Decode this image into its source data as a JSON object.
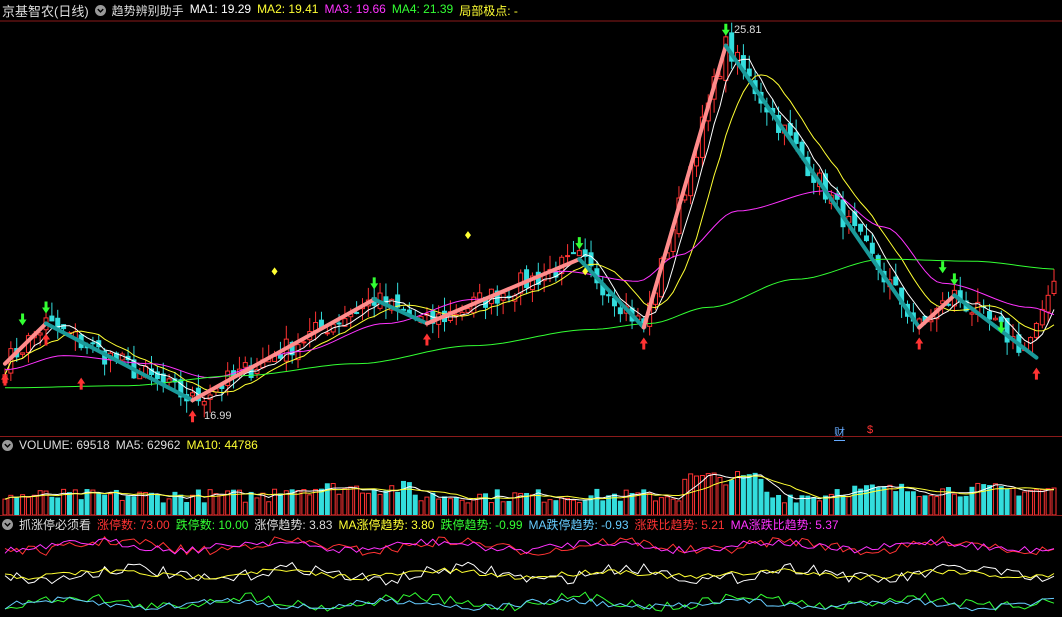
{
  "header": {
    "stock_name": "京基智农(日线)",
    "indicator_name": "趋势辨别助手",
    "items": [
      {
        "label": "MA1:",
        "value": "19.29",
        "color": "#ffffff"
      },
      {
        "label": "MA2:",
        "value": "19.41",
        "color": "#ffff33"
      },
      {
        "label": "MA3:",
        "value": "19.66",
        "color": "#ff33ff"
      },
      {
        "label": "MA4:",
        "value": "21.39",
        "color": "#33ff33"
      },
      {
        "label": "局部极点:",
        "value": "-",
        "color": "#ffff33"
      }
    ]
  },
  "annotations": {
    "high_label": "25.81",
    "low_label": "16.99",
    "tag_cai": "财",
    "tag_s": "$"
  },
  "volume_header": {
    "items": [
      {
        "label": "VOLUME:",
        "value": "69518",
        "color": "#dddddd"
      },
      {
        "label": "MA5:",
        "value": "62962",
        "color": "#dddddd"
      },
      {
        "label": "MA10:",
        "value": "44786",
        "color": "#ffff33"
      }
    ]
  },
  "limit_header": {
    "name": "抓涨停必须看",
    "items": [
      {
        "label": "涨停数:",
        "value": "73.00",
        "color": "#ff3333"
      },
      {
        "label": "跌停数:",
        "value": "10.00",
        "color": "#33ff33"
      },
      {
        "label": "涨停趋势:",
        "value": "3.83",
        "color": "#dddddd"
      },
      {
        "label": "MA涨停趋势:",
        "value": "3.80",
        "color": "#ffff33"
      },
      {
        "label": "跌停趋势:",
        "value": "-0.99",
        "color": "#33ff33"
      },
      {
        "label": "MA跌停趋势:",
        "value": "-0.93",
        "color": "#66ccff"
      },
      {
        "label": "涨跌比趋势:",
        "value": "5.21",
        "color": "#ff3333"
      },
      {
        "label": "MA涨跌比趋势:",
        "value": "5.37",
        "color": "#ff33ff"
      }
    ]
  },
  "colors": {
    "up": "#ff3333",
    "down": "#33dddd",
    "zigzag_up": "#ff8c8c",
    "zigzag_down": "#1a9a9a",
    "ma1": "#ffffff",
    "ma2": "#ffff33",
    "ma3": "#ff33ff",
    "ma4": "#33ff33"
  },
  "chart_data": {
    "type": "candlestick",
    "ylim": [
      16.2,
      26.4
    ],
    "candle_count": 180,
    "zigzag_points": [
      {
        "i": 0,
        "price": 17.9
      },
      {
        "i": 7,
        "price": 18.9
      },
      {
        "i": 32,
        "price": 16.99
      },
      {
        "i": 63,
        "price": 19.5
      },
      {
        "i": 72,
        "price": 18.9
      },
      {
        "i": 98,
        "price": 20.5
      },
      {
        "i": 109,
        "price": 18.8
      },
      {
        "i": 123,
        "price": 25.81
      },
      {
        "i": 156,
        "price": 18.8
      },
      {
        "i": 162,
        "price": 19.6
      },
      {
        "i": 176,
        "price": 18.05
      }
    ],
    "ma4": [
      [
        0,
        17.3
      ],
      [
        20,
        17.35
      ],
      [
        40,
        17.6
      ],
      [
        60,
        17.9
      ],
      [
        80,
        18.35
      ],
      [
        100,
        18.75
      ],
      [
        110,
        18.9
      ],
      [
        120,
        19.3
      ],
      [
        135,
        20.0
      ],
      [
        150,
        20.5
      ],
      [
        165,
        20.45
      ],
      [
        180,
        20.25
      ]
    ],
    "ma3": [
      [
        0,
        17.75
      ],
      [
        10,
        18.1
      ],
      [
        25,
        17.9
      ],
      [
        35,
        17.55
      ],
      [
        50,
        18.2
      ],
      [
        65,
        18.9
      ],
      [
        80,
        19.5
      ],
      [
        95,
        20.2
      ],
      [
        108,
        19.95
      ],
      [
        115,
        20.6
      ],
      [
        125,
        21.7
      ],
      [
        140,
        22.2
      ],
      [
        150,
        21.3
      ],
      [
        160,
        19.9
      ],
      [
        175,
        19.3
      ],
      [
        180,
        19.1
      ]
    ],
    "volume_ylim": [
      0,
      60000
    ],
    "volume_bars": 180
  }
}
